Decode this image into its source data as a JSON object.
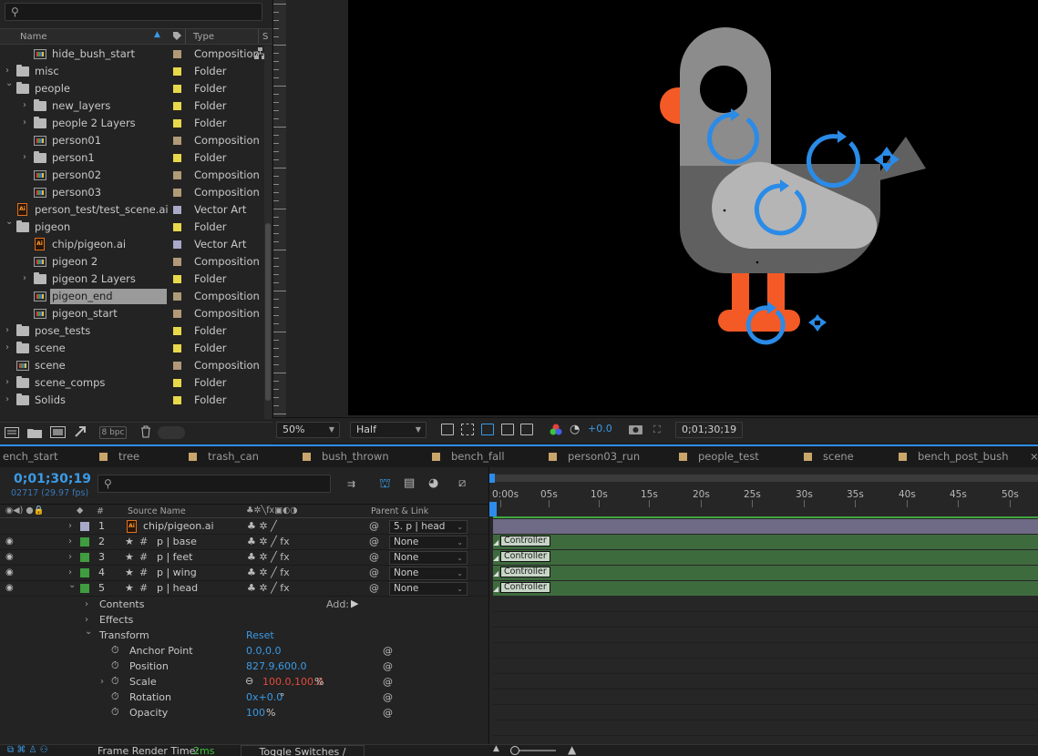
{
  "project": {
    "search_placeholder": "",
    "columns": {
      "name": "Name",
      "type": "Type",
      "size": "S"
    },
    "items": [
      {
        "name": "hide_bush_start",
        "type": "Composition",
        "kind": "comp",
        "indent": 1,
        "label": "#b09a78"
      },
      {
        "name": "misc",
        "type": "Folder",
        "kind": "folder",
        "indent": 0,
        "twirl": "›",
        "label": "#e8d84a"
      },
      {
        "name": "people",
        "type": "Folder",
        "kind": "folder",
        "indent": 0,
        "twirl": "⌄",
        "label": "#e8d84a"
      },
      {
        "name": "new_layers",
        "type": "Folder",
        "kind": "folder",
        "indent": 1,
        "twirl": "›",
        "label": "#e8d84a"
      },
      {
        "name": "people 2 Layers",
        "type": "Folder",
        "kind": "folder",
        "indent": 1,
        "twirl": "›",
        "label": "#e8d84a"
      },
      {
        "name": "person01",
        "type": "Composition",
        "kind": "comp",
        "indent": 1,
        "label": "#b09a78"
      },
      {
        "name": "person1",
        "type": "Folder",
        "kind": "folder",
        "indent": 1,
        "twirl": "›",
        "label": "#e8d84a"
      },
      {
        "name": "person02",
        "type": "Composition",
        "kind": "comp",
        "indent": 1,
        "label": "#b09a78"
      },
      {
        "name": "person03",
        "type": "Composition",
        "kind": "comp",
        "indent": 1,
        "label": "#b09a78"
      },
      {
        "name": "person_test/test_scene.ai",
        "type": "Vector Art",
        "kind": "ai",
        "indent": 0,
        "label": "#a8a8c8"
      },
      {
        "name": "pigeon",
        "type": "Folder",
        "kind": "folder",
        "indent": 0,
        "twirl": "⌄",
        "label": "#e8d84a"
      },
      {
        "name": "chip/pigeon.ai",
        "type": "Vector Art",
        "kind": "ai",
        "indent": 1,
        "label": "#a8a8c8"
      },
      {
        "name": "pigeon 2",
        "type": "Composition",
        "kind": "comp",
        "indent": 1,
        "label": "#b09a78"
      },
      {
        "name": "pigeon 2 Layers",
        "type": "Folder",
        "kind": "folder",
        "indent": 1,
        "twirl": "›",
        "label": "#e8d84a"
      },
      {
        "name": "pigeon_end",
        "type": "Composition",
        "kind": "comp",
        "indent": 1,
        "label": "#b09a78",
        "selected": true
      },
      {
        "name": "pigeon_start",
        "type": "Composition",
        "kind": "comp",
        "indent": 1,
        "label": "#b09a78"
      },
      {
        "name": "pose_tests",
        "type": "Folder",
        "kind": "folder",
        "indent": 0,
        "twirl": "›",
        "label": "#e8d84a"
      },
      {
        "name": "scene",
        "type": "Folder",
        "kind": "folder",
        "indent": 0,
        "twirl": "›",
        "label": "#e8d84a"
      },
      {
        "name": "scene",
        "type": "Composition",
        "kind": "comp",
        "indent": 0,
        "label": "#b09a78"
      },
      {
        "name": "scene_comps",
        "type": "Folder",
        "kind": "folder",
        "indent": 0,
        "twirl": "›",
        "label": "#e8d84a"
      },
      {
        "name": "Solids",
        "type": "Folder",
        "kind": "folder",
        "indent": 0,
        "twirl": "›",
        "label": "#e8d84a"
      }
    ],
    "bpc": "8 bpc"
  },
  "viewer": {
    "zoom": "50%",
    "resolution": "Half",
    "exposure": "+0.0",
    "timecode": "0;01;30;19"
  },
  "tabs": [
    "ench_start",
    "tree",
    "trash_can",
    "bush_thrown",
    "bench_fall",
    "person03_run",
    "people_test",
    "scene",
    "bench_post_bush"
  ],
  "timeline": {
    "timecode": "0;01;30;19",
    "frames": "02717 (29.97 fps)",
    "columns": {
      "num": "#",
      "source": "Source Name",
      "parent": "Parent & Link"
    },
    "layers": [
      {
        "num": "1",
        "name": "chip/pigeon.ai",
        "parent": "5. p | head",
        "label": "#a8a8c8",
        "ai": true
      },
      {
        "num": "2",
        "name": "p | base",
        "parent": "None",
        "label": "#3f9c3f"
      },
      {
        "num": "3",
        "name": "p | feet",
        "parent": "None",
        "label": "#3f9c3f"
      },
      {
        "num": "4",
        "name": "p | wing",
        "parent": "None",
        "label": "#3f9c3f"
      },
      {
        "num": "5",
        "name": "p | head",
        "parent": "None",
        "label": "#3f9c3f"
      }
    ],
    "groups": {
      "contents": "Contents",
      "add": "Add:",
      "effects": "Effects",
      "transform": "Transform",
      "reset": "Reset"
    },
    "properties": [
      {
        "name": "Anchor Point",
        "value": "0.0,0.0"
      },
      {
        "name": "Position",
        "value": "827.9,600.0"
      },
      {
        "name": "Scale",
        "value": "100.0,100.0",
        "unit": "%"
      },
      {
        "name": "Rotation",
        "value": "0x+0.0",
        "unit": "°"
      },
      {
        "name": "Opacity",
        "value": "100",
        "unit": "%"
      }
    ],
    "ruler_ticks": [
      "0:00s",
      "05s",
      "10s",
      "15s",
      "20s",
      "25s",
      "30s",
      "35s",
      "40s",
      "45s",
      "50s"
    ],
    "bar_label": "Controller"
  },
  "footer": {
    "render_label": "Frame Render Time:",
    "render_value": "2ms",
    "toggle": "Toggle Switches / Modes"
  },
  "colors": {
    "accent": "#2d8ceb",
    "pigeon_orange": "#f45a25",
    "controller_blue": "#2a8be8"
  }
}
